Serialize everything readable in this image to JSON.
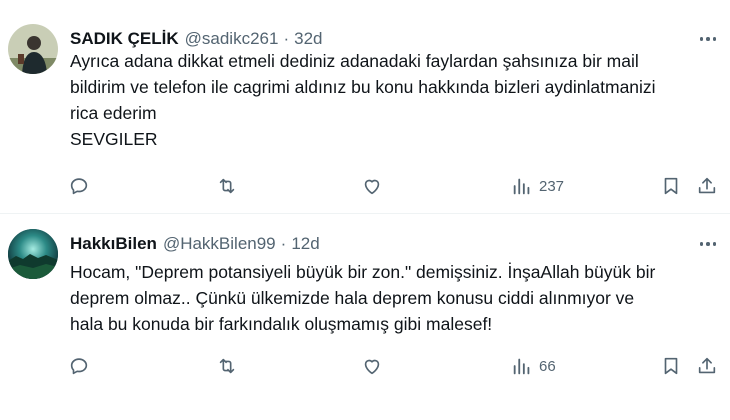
{
  "tweets": [
    {
      "author_name": "SADIK ÇELİK",
      "handle": "@sadikc261",
      "separator": "·",
      "time": "32d",
      "lines": [
        "Ayrıca adana dikkat etmeli dediniz  adanadaki faylardan şahsınıza bir mail",
        "bildirim ve telefon ile cagrimi aldınız bu konu hakkında bizleri aydinlatmanizi",
        "rica ederim",
        "SEVGILER"
      ],
      "views": "237",
      "avatar_icon": "person-photo-icon"
    },
    {
      "author_name": "HakkıBilen",
      "handle": "@HakkBilen99",
      "separator": "·",
      "time": "12d",
      "lines": [
        "Hocam, \"Deprem potansiyeli büyük bir zon.\" demişsiniz. İnşaAllah büyük bir",
        "deprem olmaz.. Çünkü ülkemizde hala deprem konusu ciddi alınmıyor ve",
        "hala bu konuda bir farkındalık oluşmamış gibi  malesef!"
      ],
      "views": "66",
      "avatar_icon": "landscape-photo-icon"
    }
  ],
  "icons": {
    "reply": "reply-icon",
    "retweet": "retweet-icon",
    "like": "heart-icon",
    "views": "views-chart-icon",
    "bookmark": "bookmark-icon",
    "share": "share-icon",
    "more": "more-options-icon"
  },
  "colors": {
    "text": "#0f1419",
    "secondary": "#536471",
    "divider": "#eff3f4",
    "background": "#ffffff"
  }
}
